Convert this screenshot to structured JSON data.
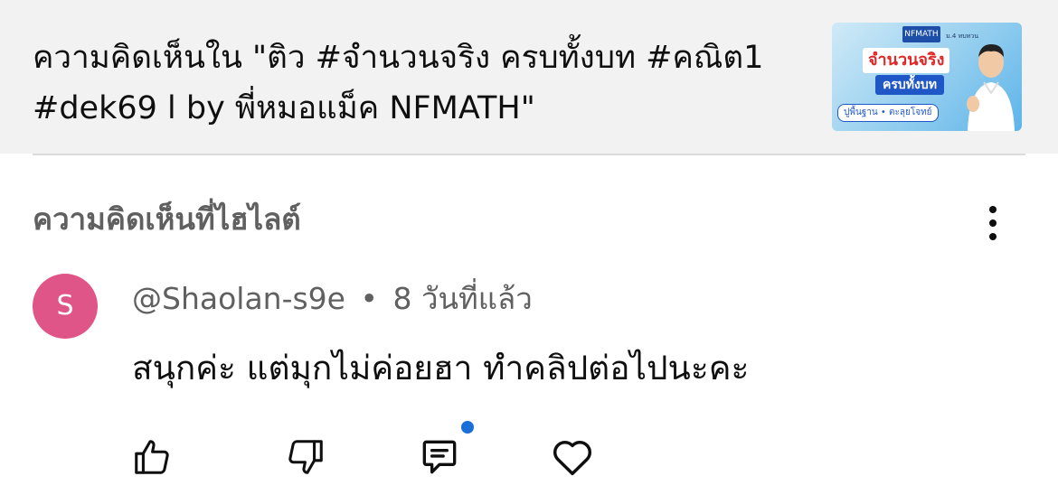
{
  "header": {
    "title": "ความคิดเห็นใน \"ติว #จำนวนจริง ครบทั้งบท #คณิต1 #dek69 l by พี่หมอแม็ค NFMATH\"",
    "thumbnail": {
      "brand": "NFMATH",
      "tag": "ม.4 ทบทวน",
      "line1": "จำนวนจริง",
      "line2": "ครบทั้งบท",
      "line3": "ปูพื้นฐาน • ตะลุยโจทย์",
      "colors": {
        "bg": "#5db4ea",
        "accent_red": "#e02828",
        "accent_blue": "#1f57c7"
      }
    }
  },
  "section": {
    "title": "ความคิดเห็นที่ไฮไลต์",
    "more_icon": "vertical-ellipsis-icon"
  },
  "comment": {
    "avatar_letter": "S",
    "avatar_color": "#e05587",
    "author": "@Shaolan-s9e",
    "separator": "•",
    "time": "8 วันที่แล้ว",
    "text": "สนุกค่ะ แต่มุกไม่ค่อยฮา ทำคลิปต่อไปนะคะ",
    "actions": [
      {
        "icon": "thumbs-up-icon"
      },
      {
        "icon": "thumbs-down-icon"
      },
      {
        "icon": "reply-comment-icon",
        "has_badge": true,
        "badge_color": "#1a6fd6"
      },
      {
        "icon": "heart-icon"
      }
    ]
  }
}
